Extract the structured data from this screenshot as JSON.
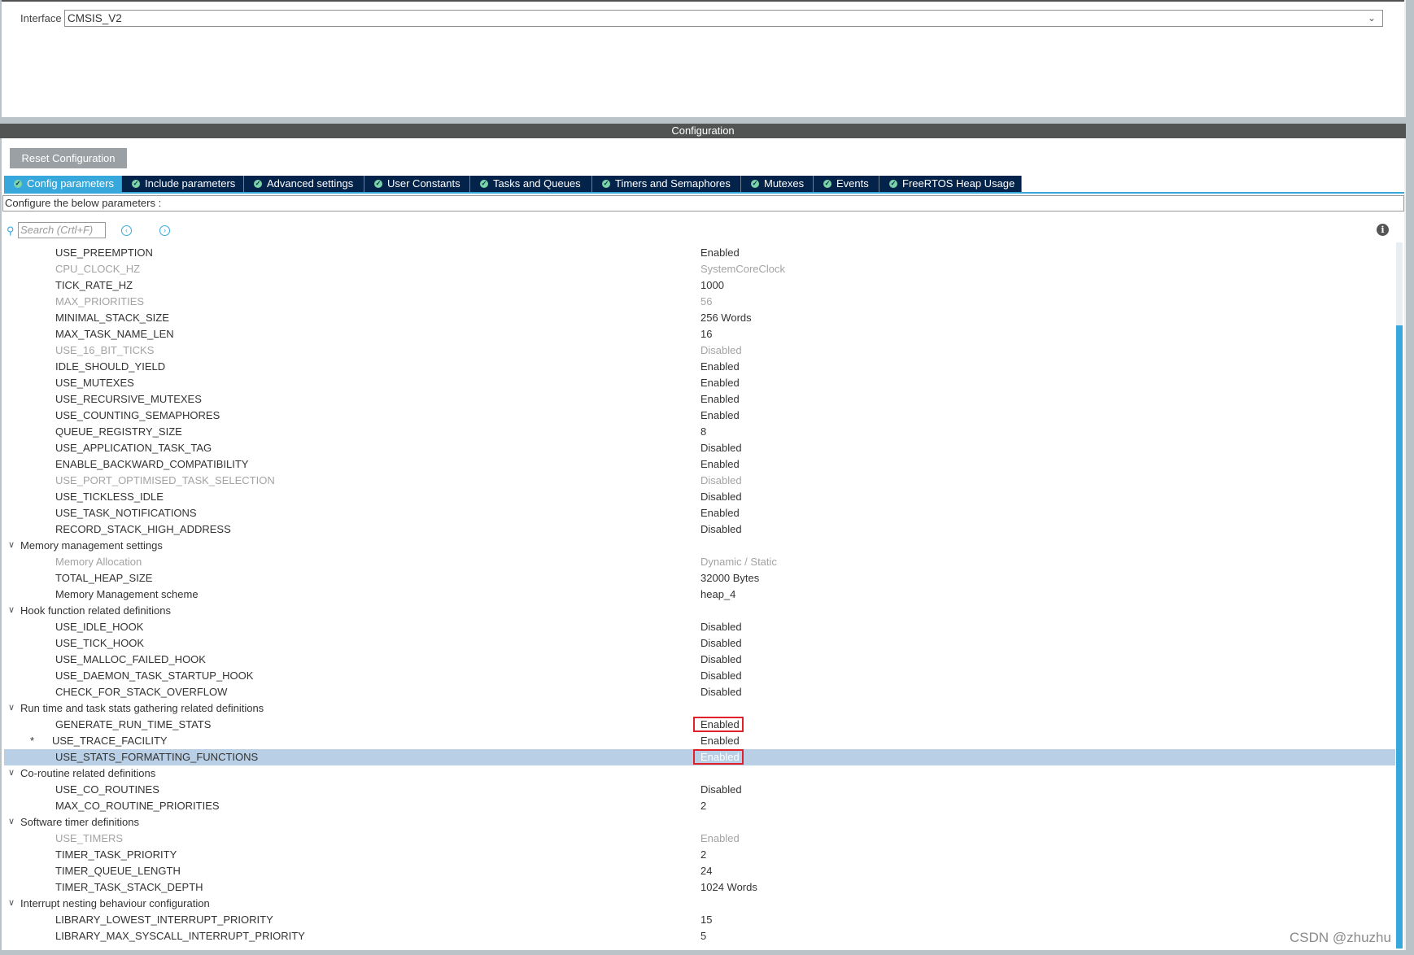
{
  "interface": {
    "label": "Interface",
    "value": "CMSIS_V2"
  },
  "section_title": "Configuration",
  "reset_label": "Reset Configuration",
  "tabs": [
    {
      "label": "Config parameters",
      "active": true
    },
    {
      "label": "Include parameters"
    },
    {
      "label": "Advanced settings"
    },
    {
      "label": "User Constants"
    },
    {
      "label": "Tasks and Queues"
    },
    {
      "label": "Timers and Semaphores"
    },
    {
      "label": "Mutexes"
    },
    {
      "label": "Events"
    },
    {
      "label": "FreeRTOS Heap Usage"
    }
  ],
  "configure_text": "Configure the below parameters :",
  "search": {
    "placeholder": "Search (Crtl+F)"
  },
  "rows": [
    {
      "name": "USE_PREEMPTION",
      "value": "Enabled"
    },
    {
      "name": "CPU_CLOCK_HZ",
      "value": "SystemCoreClock",
      "dim": true
    },
    {
      "name": "TICK_RATE_HZ",
      "value": "1000"
    },
    {
      "name": "MAX_PRIORITIES",
      "value": "56",
      "dim": true
    },
    {
      "name": "MINIMAL_STACK_SIZE",
      "value": "256 Words"
    },
    {
      "name": "MAX_TASK_NAME_LEN",
      "value": "16"
    },
    {
      "name": "USE_16_BIT_TICKS",
      "value": "Disabled",
      "dim": true
    },
    {
      "name": "IDLE_SHOULD_YIELD",
      "value": "Enabled"
    },
    {
      "name": "USE_MUTEXES",
      "value": "Enabled"
    },
    {
      "name": "USE_RECURSIVE_MUTEXES",
      "value": "Enabled"
    },
    {
      "name": "USE_COUNTING_SEMAPHORES",
      "value": "Enabled"
    },
    {
      "name": "QUEUE_REGISTRY_SIZE",
      "value": "8"
    },
    {
      "name": "USE_APPLICATION_TASK_TAG",
      "value": "Disabled"
    },
    {
      "name": "ENABLE_BACKWARD_COMPATIBILITY",
      "value": "Enabled"
    },
    {
      "name": "USE_PORT_OPTIMISED_TASK_SELECTION",
      "value": "Disabled",
      "dim": true
    },
    {
      "name": "USE_TICKLESS_IDLE",
      "value": "Disabled"
    },
    {
      "name": "USE_TASK_NOTIFICATIONS",
      "value": "Enabled"
    },
    {
      "name": "RECORD_STACK_HIGH_ADDRESS",
      "value": "Disabled"
    },
    {
      "name": "Memory management settings",
      "group": true
    },
    {
      "name": "Memory Allocation",
      "value": "Dynamic / Static",
      "dim": true
    },
    {
      "name": "TOTAL_HEAP_SIZE",
      "value": "32000 Bytes"
    },
    {
      "name": "Memory Management scheme",
      "value": "heap_4"
    },
    {
      "name": "Hook function related definitions",
      "group": true
    },
    {
      "name": "USE_IDLE_HOOK",
      "value": "Disabled"
    },
    {
      "name": "USE_TICK_HOOK",
      "value": "Disabled"
    },
    {
      "name": "USE_MALLOC_FAILED_HOOK",
      "value": "Disabled"
    },
    {
      "name": "USE_DAEMON_TASK_STARTUP_HOOK",
      "value": "Disabled"
    },
    {
      "name": "CHECK_FOR_STACK_OVERFLOW",
      "value": "Disabled"
    },
    {
      "name": "Run time and task stats gathering related definitions",
      "group": true
    },
    {
      "name": "GENERATE_RUN_TIME_STATS",
      "value": "Enabled",
      "highlight": true
    },
    {
      "name": "USE_TRACE_FACILITY",
      "value": "Enabled",
      "star": "*"
    },
    {
      "name": "USE_STATS_FORMATTING_FUNCTIONS",
      "value": "Enabled",
      "selected": true,
      "highlight": true
    },
    {
      "name": "Co-routine related definitions",
      "group": true
    },
    {
      "name": "USE_CO_ROUTINES",
      "value": "Disabled"
    },
    {
      "name": "MAX_CO_ROUTINE_PRIORITIES",
      "value": "2"
    },
    {
      "name": "Software timer definitions",
      "group": true
    },
    {
      "name": "USE_TIMERS",
      "value": "Enabled",
      "dim": true
    },
    {
      "name": "TIMER_TASK_PRIORITY",
      "value": "2"
    },
    {
      "name": "TIMER_QUEUE_LENGTH",
      "value": "24"
    },
    {
      "name": "TIMER_TASK_STACK_DEPTH",
      "value": "1024 Words"
    },
    {
      "name": "Interrupt nesting behaviour configuration",
      "group": true
    },
    {
      "name": "LIBRARY_LOWEST_INTERRUPT_PRIORITY",
      "value": "15"
    },
    {
      "name": "LIBRARY_MAX_SYSCALL_INTERRUPT_PRIORITY",
      "value": "5"
    }
  ],
  "watermark": "CSDN @zhuzhu",
  "colors": {
    "tab_bg": "#04234a",
    "tab_active": "#37a8dc",
    "header_bg": "#525453",
    "selected_row": "#b8cfe6",
    "highlight_box": "#e0202a"
  }
}
